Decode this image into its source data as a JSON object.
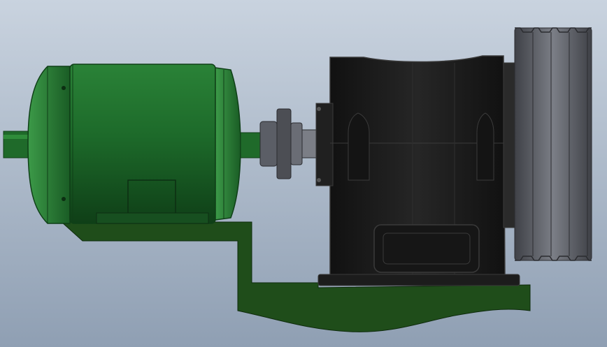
{
  "scene": {
    "description_visible_text": "",
    "colors": {
      "background_top": "#c9d3df",
      "background_bottom": "#8f9fb3",
      "motor_green": "#1d6a2a",
      "motor_green_light": "#2f8c3a",
      "motor_green_dark": "#0f3f17",
      "frame_green": "#1f4d1a",
      "gearbox_black": "#1a1a1a",
      "gearbox_edge": "#3a3a3a",
      "pulley_gray": "#4c4e54",
      "pulley_light": "#7b7e86",
      "coupling_gray": "#5b5e66",
      "shaft_green": "#1f6a2a"
    }
  }
}
